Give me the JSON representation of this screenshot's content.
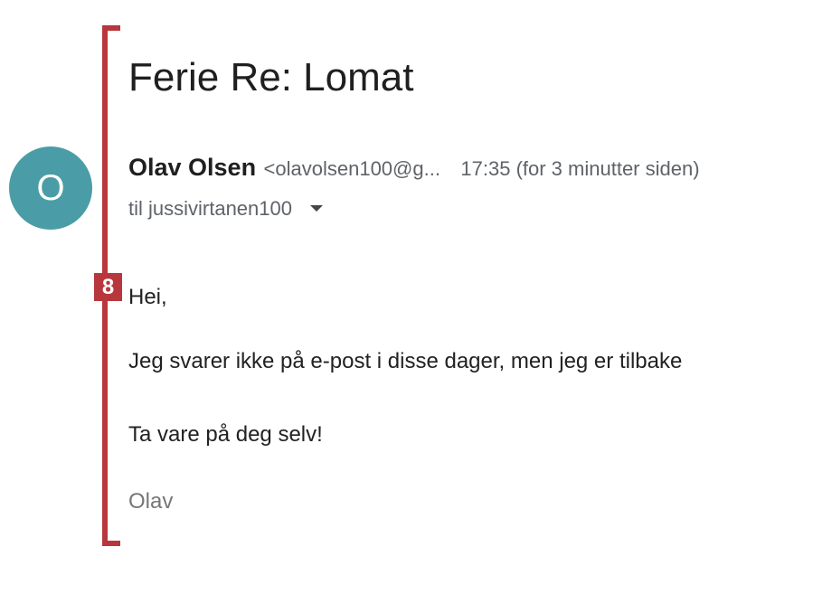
{
  "annotation": {
    "badge_number": "8",
    "color": "#b8373d"
  },
  "email": {
    "subject": "Ferie Re: Lomat",
    "avatar": {
      "initial": "O",
      "color": "#4a9da6"
    },
    "sender": {
      "name": "Olav Olsen",
      "email": "<olavolsen100@g..."
    },
    "timestamp": "17:35 (for 3 minutter siden)",
    "recipient": "til jussivirtanen100",
    "recipient_icon": "chevron-down-icon",
    "body": {
      "greeting": "Hei,",
      "paragraph_1": "Jeg svarer ikke på e-post i disse dager, men jeg er tilbake",
      "paragraph_2": "Ta vare på deg selv!",
      "signature": "Olav"
    }
  }
}
